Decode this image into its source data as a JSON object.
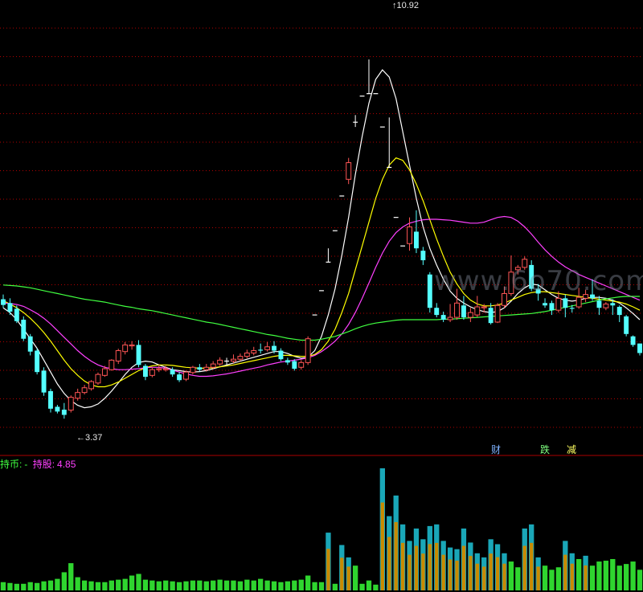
{
  "watermark": "www.6o70.com",
  "annotations": {
    "high_label": "10.92",
    "low_label": "3.37"
  },
  "signals": [
    {
      "text": "财",
      "color": "#7fb2ff"
    },
    {
      "text": "跌",
      "color": "#80ff80"
    },
    {
      "text": "减",
      "color": "#ffff60"
    }
  ],
  "status": {
    "label1": "持币:",
    "value1": "-",
    "label2": "持股:",
    "value2": "4.85"
  },
  "colors": {
    "background": "#000000",
    "up": "#ff5555",
    "down": "#54ffff",
    "ma_white": "#ffffff",
    "ma_yellow": "#ffff00",
    "ma_magenta": "#ff40ff",
    "ma_green": "#40ff40",
    "grid": "#b00000",
    "separator": "#aa0000",
    "vol_teal": "#1aa7b8",
    "vol_orange": "#c88a00",
    "vol_green": "#2fd52f"
  },
  "chart_data": {
    "type": "candlestick",
    "price_range": [
      2.8,
      12.0
    ],
    "high": 10.92,
    "low": 3.37,
    "candles": [
      [
        5.88,
        5.76,
        5.98,
        5.7
      ],
      [
        5.8,
        5.62,
        5.9,
        5.55
      ],
      [
        5.68,
        5.42,
        5.75,
        5.38
      ],
      [
        5.45,
        5.05,
        5.52,
        5.0
      ],
      [
        5.1,
        4.78,
        5.15,
        4.7
      ],
      [
        4.8,
        4.35,
        4.85,
        4.3
      ],
      [
        4.38,
        3.92,
        4.45,
        3.85
      ],
      [
        3.95,
        3.58,
        4.0,
        3.5
      ],
      [
        3.62,
        3.52,
        3.66,
        3.48
      ],
      [
        3.56,
        3.45,
        3.7,
        3.37
      ],
      [
        3.55,
        3.82,
        3.86,
        3.5
      ],
      [
        3.8,
        3.92,
        4.0,
        3.75
      ],
      [
        3.92,
        4.02,
        4.08,
        3.88
      ],
      [
        4.0,
        4.15,
        4.18,
        3.96
      ],
      [
        4.12,
        4.3,
        4.34,
        4.08
      ],
      [
        4.28,
        4.42,
        4.48,
        4.25
      ],
      [
        4.4,
        4.6,
        4.62,
        4.38
      ],
      [
        4.58,
        4.8,
        4.84,
        4.52
      ],
      [
        4.78,
        4.92,
        4.98,
        4.72
      ],
      [
        4.9,
        4.92,
        5.0,
        4.82
      ],
      [
        4.92,
        4.5,
        5.02,
        4.45
      ],
      [
        4.48,
        4.25,
        4.52,
        4.18
      ],
      [
        4.28,
        4.4,
        4.45,
        4.24
      ],
      [
        4.4,
        4.42,
        4.5,
        4.35
      ],
      [
        4.4,
        4.42,
        4.48,
        4.36
      ],
      [
        4.4,
        4.3,
        4.45,
        4.25
      ],
      [
        4.3,
        4.18,
        4.35,
        4.14
      ],
      [
        4.2,
        4.35,
        4.38,
        4.16
      ],
      [
        4.34,
        4.45,
        4.48,
        4.3
      ],
      [
        4.45,
        4.4,
        4.52,
        4.36
      ],
      [
        4.4,
        4.45,
        4.52,
        4.36
      ],
      [
        4.45,
        4.52,
        4.58,
        4.42
      ],
      [
        4.52,
        4.6,
        4.66,
        4.48
      ],
      [
        4.58,
        4.58,
        4.65,
        4.5
      ],
      [
        4.58,
        4.62,
        4.72,
        4.54
      ],
      [
        4.62,
        4.68,
        4.74,
        4.58
      ],
      [
        4.68,
        4.75,
        4.82,
        4.64
      ],
      [
        4.75,
        4.8,
        4.88,
        4.7
      ],
      [
        4.82,
        4.8,
        4.95,
        4.74
      ],
      [
        4.82,
        4.88,
        4.98,
        4.78
      ],
      [
        4.9,
        4.8,
        5.0,
        4.74
      ],
      [
        4.8,
        4.62,
        4.85,
        4.58
      ],
      [
        4.6,
        4.55,
        4.65,
        4.5
      ],
      [
        4.58,
        4.42,
        4.62,
        4.38
      ],
      [
        4.45,
        4.55,
        4.6,
        4.4
      ],
      [
        4.55,
        5.05,
        5.1,
        4.5
      ],
      [
        5.55,
        5.55,
        5.55,
        5.55
      ],
      [
        6.06,
        6.06,
        6.06,
        6.06
      ],
      [
        6.66,
        6.66,
        6.95,
        6.66
      ],
      [
        7.32,
        7.32,
        7.32,
        7.32
      ],
      [
        8.05,
        8.05,
        8.05,
        8.05
      ],
      [
        8.4,
        8.75,
        8.85,
        8.3
      ],
      [
        9.6,
        9.6,
        9.75,
        9.5
      ],
      [
        10.15,
        10.15,
        10.15,
        10.15
      ],
      [
        10.2,
        10.2,
        10.92,
        10.2
      ],
      [
        10.2,
        10.2,
        10.2,
        10.2
      ],
      [
        9.5,
        9.5,
        9.5,
        9.5
      ],
      [
        8.65,
        8.65,
        9.7,
        8.65
      ],
      [
        7.6,
        7.6,
        7.6,
        7.6
      ],
      [
        7.0,
        7.0,
        7.0,
        7.0
      ],
      [
        7.05,
        7.4,
        7.6,
        6.9
      ],
      [
        7.3,
        6.95,
        7.75,
        6.85
      ],
      [
        6.9,
        6.7,
        6.98,
        6.6
      ],
      [
        6.4,
        5.7,
        6.45,
        5.6
      ],
      [
        5.7,
        5.55,
        5.8,
        5.5
      ],
      [
        5.55,
        5.45,
        5.62,
        5.4
      ],
      [
        5.45,
        5.5,
        5.78,
        5.4
      ],
      [
        5.5,
        5.8,
        6.1,
        5.45
      ],
      [
        5.75,
        5.5,
        5.95,
        5.45
      ],
      [
        5.5,
        5.6,
        5.7,
        5.4
      ],
      [
        5.55,
        5.72,
        5.95,
        5.5
      ],
      [
        5.7,
        5.72,
        5.78,
        5.6
      ],
      [
        5.7,
        5.38,
        5.8,
        5.35
      ],
      [
        5.4,
        5.75,
        5.8,
        5.38
      ],
      [
        5.75,
        6.0,
        6.15,
        5.7
      ],
      [
        6.0,
        6.45,
        6.8,
        5.95
      ],
      [
        6.5,
        6.55,
        6.6,
        6.4
      ],
      [
        6.55,
        6.72,
        6.78,
        6.5
      ],
      [
        6.6,
        6.1,
        6.7,
        6.05
      ],
      [
        6.1,
        6.0,
        6.2,
        5.85
      ],
      [
        5.8,
        5.75,
        5.9,
        5.7
      ],
      [
        5.8,
        5.65,
        5.85,
        5.55
      ],
      [
        5.65,
        5.9,
        6.05,
        5.6
      ],
      [
        5.9,
        5.7,
        5.98,
        5.5
      ],
      [
        5.7,
        5.68,
        5.76,
        5.6
      ],
      [
        5.72,
        5.92,
        6.12,
        5.68
      ],
      [
        5.9,
        5.98,
        6.08,
        5.82
      ],
      [
        5.98,
        5.9,
        6.3,
        5.85
      ],
      [
        5.85,
        5.7,
        5.95,
        5.55
      ],
      [
        5.7,
        5.78,
        5.82,
        5.65
      ],
      [
        5.8,
        5.75,
        5.88,
        5.55
      ],
      [
        5.72,
        5.55,
        5.75,
        5.4
      ],
      [
        5.52,
        5.15,
        5.55,
        5.1
      ],
      [
        5.1,
        4.92,
        5.12,
        4.88
      ],
      [
        4.95,
        4.75,
        4.95,
        4.7
      ]
    ],
    "moving_averages": [
      {
        "color_key": "ma_white",
        "values": [
          5.7,
          5.6,
          5.45,
          5.25,
          5.05,
          4.85,
          4.6,
          4.35,
          4.1,
          3.9,
          3.75,
          3.65,
          3.6,
          3.62,
          3.68,
          3.8,
          3.95,
          4.12,
          4.3,
          4.45,
          4.55,
          4.58,
          4.56,
          4.5,
          4.45,
          4.4,
          4.38,
          4.36,
          4.35,
          4.36,
          4.38,
          4.42,
          4.46,
          4.5,
          4.54,
          4.58,
          4.62,
          4.66,
          4.7,
          4.74,
          4.78,
          4.78,
          4.74,
          4.68,
          4.64,
          4.66,
          4.8,
          5.1,
          5.55,
          6.1,
          6.8,
          7.6,
          8.5,
          9.3,
          10.0,
          10.5,
          10.7,
          10.55,
          10.1,
          9.4,
          8.7,
          8.0,
          7.4,
          6.95,
          6.6,
          6.3,
          6.05,
          5.9,
          5.8,
          5.72,
          5.66,
          5.62,
          5.6,
          5.62,
          5.7,
          5.84,
          6.0,
          6.12,
          6.2,
          6.18,
          6.08,
          5.98,
          5.9,
          5.86,
          5.84,
          5.86,
          5.9,
          5.92,
          5.92,
          5.9,
          5.86,
          5.8,
          5.7,
          5.58,
          5.45
        ]
      },
      {
        "color_key": "ma_yellow",
        "values": [
          5.85,
          5.78,
          5.7,
          5.6,
          5.48,
          5.34,
          5.18,
          5.0,
          4.8,
          4.6,
          4.42,
          4.28,
          4.16,
          4.08,
          4.04,
          4.04,
          4.08,
          4.14,
          4.22,
          4.3,
          4.38,
          4.44,
          4.48,
          4.5,
          4.5,
          4.49,
          4.47,
          4.45,
          4.44,
          4.43,
          4.43,
          4.44,
          4.46,
          4.48,
          4.5,
          4.53,
          4.56,
          4.59,
          4.62,
          4.65,
          4.68,
          4.7,
          4.7,
          4.69,
          4.68,
          4.68,
          4.72,
          4.82,
          5.0,
          5.25,
          5.6,
          6.0,
          6.5,
          7.0,
          7.5,
          8.0,
          8.4,
          8.7,
          8.85,
          8.8,
          8.6,
          8.3,
          7.95,
          7.55,
          7.15,
          6.78,
          6.45,
          6.2,
          6.0,
          5.86,
          5.78,
          5.74,
          5.74,
          5.76,
          5.8,
          5.86,
          5.92,
          5.98,
          6.02,
          6.04,
          6.04,
          6.02,
          6.0,
          5.98,
          5.96,
          5.94,
          5.92,
          5.9,
          5.88,
          5.86,
          5.84,
          5.82,
          5.78,
          5.72,
          5.65
        ]
      },
      {
        "color_key": "ma_magenta",
        "values": [
          5.8,
          5.79,
          5.77,
          5.73,
          5.66,
          5.58,
          5.48,
          5.36,
          5.22,
          5.08,
          4.94,
          4.8,
          4.68,
          4.58,
          4.5,
          4.45,
          4.42,
          4.4,
          4.4,
          4.41,
          4.42,
          4.44,
          4.45,
          4.45,
          4.43,
          4.39,
          4.35,
          4.31,
          4.28,
          4.26,
          4.26,
          4.27,
          4.29,
          4.31,
          4.34,
          4.37,
          4.4,
          4.43,
          4.46,
          4.5,
          4.53,
          4.56,
          4.58,
          4.6,
          4.62,
          4.65,
          4.7,
          4.78,
          4.88,
          5.0,
          5.15,
          5.35,
          5.6,
          5.9,
          6.22,
          6.55,
          6.85,
          7.1,
          7.28,
          7.4,
          7.48,
          7.52,
          7.55,
          7.56,
          7.56,
          7.55,
          7.54,
          7.52,
          7.5,
          7.48,
          7.48,
          7.5,
          7.55,
          7.6,
          7.62,
          7.6,
          7.52,
          7.4,
          7.25,
          7.08,
          6.92,
          6.78,
          6.66,
          6.56,
          6.48,
          6.4,
          6.34,
          6.28,
          6.22,
          6.16,
          6.1,
          6.04,
          5.98,
          5.92,
          5.86
        ]
      },
      {
        "color_key": "ma_green",
        "values": [
          6.18,
          6.17,
          6.16,
          6.14,
          6.12,
          6.09,
          6.06,
          6.03,
          6.0,
          5.97,
          5.94,
          5.91,
          5.88,
          5.86,
          5.84,
          5.82,
          5.79,
          5.76,
          5.73,
          5.71,
          5.68,
          5.66,
          5.64,
          5.61,
          5.58,
          5.55,
          5.52,
          5.49,
          5.46,
          5.43,
          5.4,
          5.38,
          5.35,
          5.32,
          5.29,
          5.26,
          5.23,
          5.2,
          5.17,
          5.14,
          5.12,
          5.09,
          5.06,
          5.04,
          5.02,
          5.02,
          5.02,
          5.04,
          5.07,
          5.1,
          5.15,
          5.2,
          5.26,
          5.31,
          5.35,
          5.38,
          5.4,
          5.42,
          5.44,
          5.45,
          5.45,
          5.45,
          5.45,
          5.45,
          5.45,
          5.46,
          5.46,
          5.47,
          5.48,
          5.49,
          5.5,
          5.51,
          5.52,
          5.53,
          5.54,
          5.55,
          5.56,
          5.57,
          5.58,
          5.6,
          5.62,
          5.65,
          5.68,
          5.71,
          5.74,
          5.77,
          5.8,
          5.83,
          5.86,
          5.89,
          5.91,
          5.93,
          5.94,
          5.94,
          5.94
        ]
      }
    ],
    "volume": [
      10,
      9,
      8,
      8,
      10,
      9,
      11,
      12,
      14,
      22,
      33,
      16,
      12,
      11,
      10,
      10,
      12,
      13,
      14,
      18,
      20,
      13,
      12,
      11,
      12,
      11,
      10,
      11,
      12,
      12,
      11,
      12,
      13,
      12,
      12,
      11,
      13,
      12,
      14,
      12,
      11,
      10,
      11,
      12,
      13,
      18,
      10,
      10,
      70,
      8,
      55,
      40,
      30,
      8,
      12,
      7,
      148,
      90,
      115,
      80,
      60,
      75,
      62,
      78,
      80,
      60,
      52,
      50,
      75,
      58,
      45,
      40,
      62,
      56,
      45,
      35,
      28,
      75,
      80,
      40,
      30,
      25,
      28,
      60,
      45,
      38,
      42,
      30,
      35,
      36,
      38,
      30,
      32,
      35,
      25
    ]
  }
}
